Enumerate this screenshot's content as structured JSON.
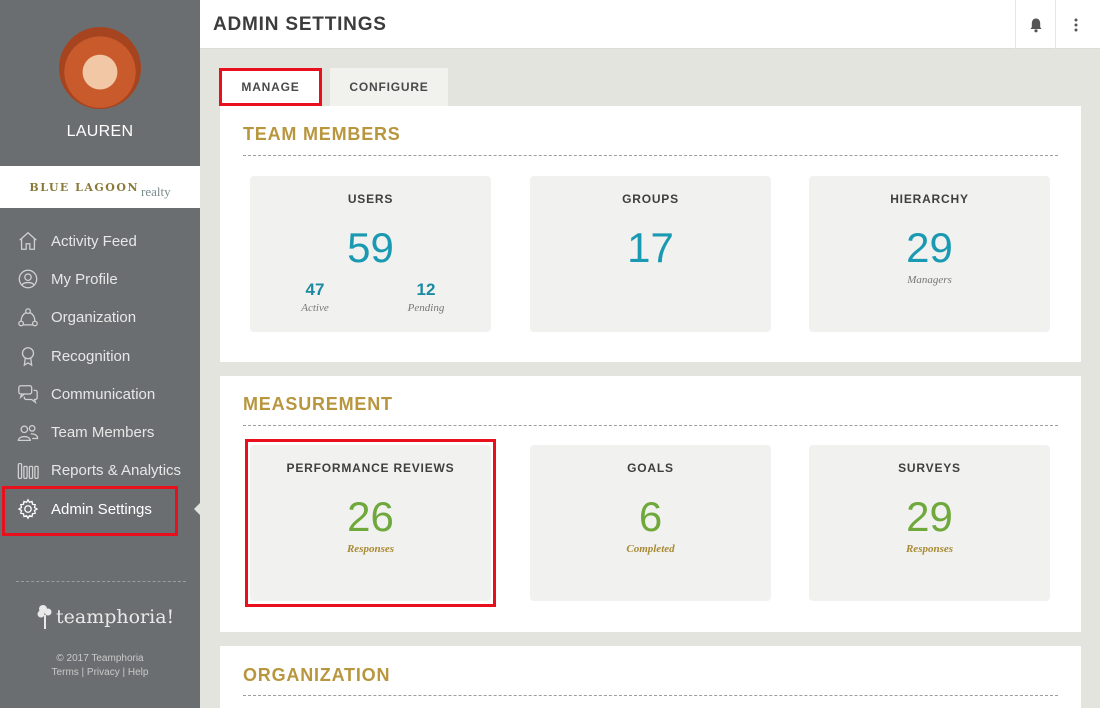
{
  "sidebar": {
    "username": "LAUREN",
    "brand": {
      "main": "BLUE LAGOON",
      "sub": "realty"
    },
    "items": [
      {
        "label": "Activity Feed",
        "icon": "home-icon"
      },
      {
        "label": "My Profile",
        "icon": "user-circle-icon"
      },
      {
        "label": "Organization",
        "icon": "organization-icon"
      },
      {
        "label": "Recognition",
        "icon": "award-ribbon-icon"
      },
      {
        "label": "Communication",
        "icon": "chat-bubbles-icon"
      },
      {
        "label": "Team Members",
        "icon": "team-icon"
      },
      {
        "label": "Reports & Analytics",
        "icon": "bars-icon"
      },
      {
        "label": "Admin Settings",
        "icon": "gear-icon",
        "active": true
      }
    ],
    "footer_logo": "teamphoria!",
    "copyright": "© 2017 Teamphoria",
    "links": "Terms | Privacy | Help"
  },
  "header": {
    "title": "ADMIN SETTINGS",
    "icons": [
      "bell-icon",
      "more-vertical-icon"
    ]
  },
  "tabs": [
    {
      "label": "MANAGE",
      "active": true
    },
    {
      "label": "CONFIGURE",
      "active": false
    }
  ],
  "team_members": {
    "title": "TEAM MEMBERS",
    "users": {
      "title": "USERS",
      "value": "59",
      "active_value": "47",
      "active_label": "Active",
      "pending_value": "12",
      "pending_label": "Pending"
    },
    "groups": {
      "title": "GROUPS",
      "value": "17"
    },
    "hierarchy": {
      "title": "HIERARCHY",
      "value": "29",
      "caption": "Managers"
    }
  },
  "measurement": {
    "title": "MEASUREMENT",
    "performance_reviews": {
      "title": "PERFORMANCE REVIEWS",
      "value": "26",
      "caption": "Responses"
    },
    "goals": {
      "title": "GOALS",
      "value": "6",
      "caption": "Completed"
    },
    "surveys": {
      "title": "SURVEYS",
      "value": "29",
      "caption": "Responses"
    }
  },
  "organization": {
    "title": "ORGANIZATION"
  },
  "colors": {
    "sidebar_bg": "#6b6e70",
    "accent_gold": "#b8963e",
    "teal": "#1a9ab2",
    "green": "#6fa83b",
    "highlight_red": "#e8101c"
  }
}
